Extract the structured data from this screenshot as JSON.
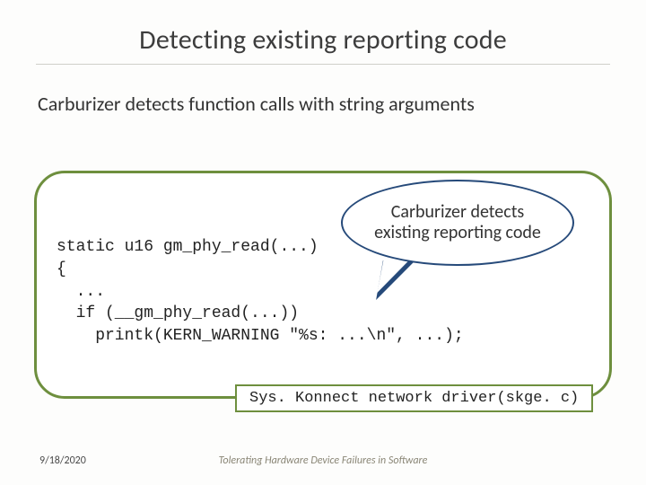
{
  "title": "Detecting existing reporting code",
  "subtitle": "Carburizer detects function calls with string arguments",
  "callout": "Carburizer detects existing reporting code",
  "code": {
    "line1": "static u16 gm_phy_read(...)",
    "line2": "{",
    "line3": "  ...",
    "line4": "  if (__gm_phy_read(...))",
    "line5": "    printk(KERN_WARNING \"%s: ...\\n\", ...);"
  },
  "caption": "Sys. Konnect network driver(skge. c)",
  "footer": {
    "date": "9/18/2020",
    "talk": "Tolerating Hardware Device Failures in Software"
  }
}
